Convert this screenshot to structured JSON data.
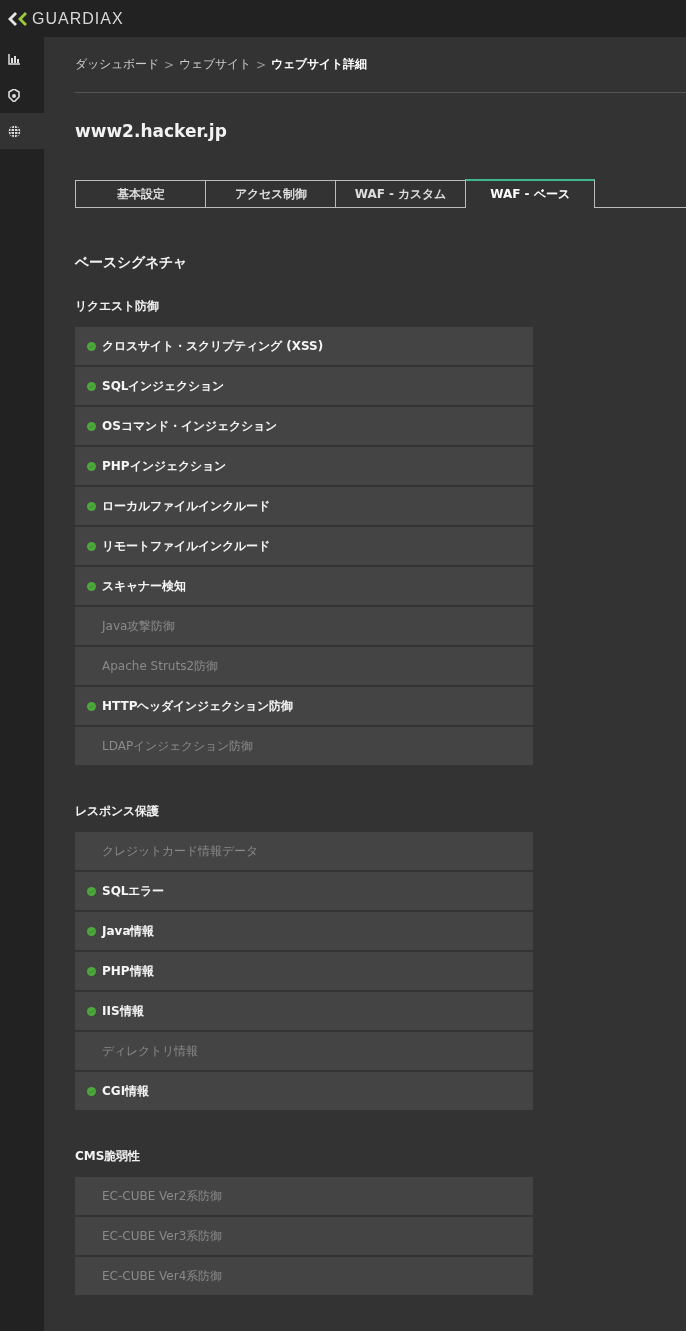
{
  "header": {
    "brand": "GUARDIAX"
  },
  "sidebar": {
    "items": [
      {
        "kind": "chart",
        "selected": false
      },
      {
        "kind": "shield",
        "selected": false
      },
      {
        "kind": "globe",
        "selected": true
      }
    ]
  },
  "breadcrumb": {
    "separator": ">",
    "items": [
      {
        "label": "ダッシュボード",
        "current": false
      },
      {
        "label": "ウェブサイト",
        "current": false
      },
      {
        "label": "ウェブサイト詳細",
        "current": true
      }
    ]
  },
  "title": "www2.hacker.jp",
  "tabs": [
    {
      "label": "基本設定",
      "selected": false
    },
    {
      "label": "アクセス制御",
      "selected": false
    },
    {
      "label": "WAF - カスタム",
      "selected": false
    },
    {
      "label": "WAF - ベース",
      "selected": true
    }
  ],
  "heading": "ベースシグネチャ",
  "sections": [
    {
      "title": "リクエスト防御",
      "items": [
        {
          "label": "クロスサイト・スクリプティング (XSS)",
          "enabled": true
        },
        {
          "label": "SQLインジェクション",
          "enabled": true
        },
        {
          "label": "OSコマンド・インジェクション",
          "enabled": true
        },
        {
          "label": "PHPインジェクション",
          "enabled": true
        },
        {
          "label": "ローカルファイルインクルード",
          "enabled": true
        },
        {
          "label": "リモートファイルインクルード",
          "enabled": true
        },
        {
          "label": "スキャナー検知",
          "enabled": true
        },
        {
          "label": "Java攻撃防御",
          "enabled": false
        },
        {
          "label": "Apache Struts2防御",
          "enabled": false
        },
        {
          "label": "HTTPヘッダインジェクション防御",
          "enabled": true
        },
        {
          "label": "LDAPインジェクション防御",
          "enabled": false
        }
      ]
    },
    {
      "title": "レスポンス保護",
      "items": [
        {
          "label": "クレジットカード情報データ",
          "enabled": false
        },
        {
          "label": "SQLエラー",
          "enabled": true
        },
        {
          "label": "Java情報",
          "enabled": true
        },
        {
          "label": "PHP情報",
          "enabled": true
        },
        {
          "label": "IIS情報",
          "enabled": true
        },
        {
          "label": "ディレクトリ情報",
          "enabled": false
        },
        {
          "label": "CGI情報",
          "enabled": true
        }
      ]
    },
    {
      "title": "CMS脆弱性",
      "items": [
        {
          "label": "EC-CUBE Ver2系防御",
          "enabled": false
        },
        {
          "label": "EC-CUBE Ver3系防御",
          "enabled": false
        },
        {
          "label": "EC-CUBE Ver4系防御",
          "enabled": false
        }
      ]
    }
  ]
}
